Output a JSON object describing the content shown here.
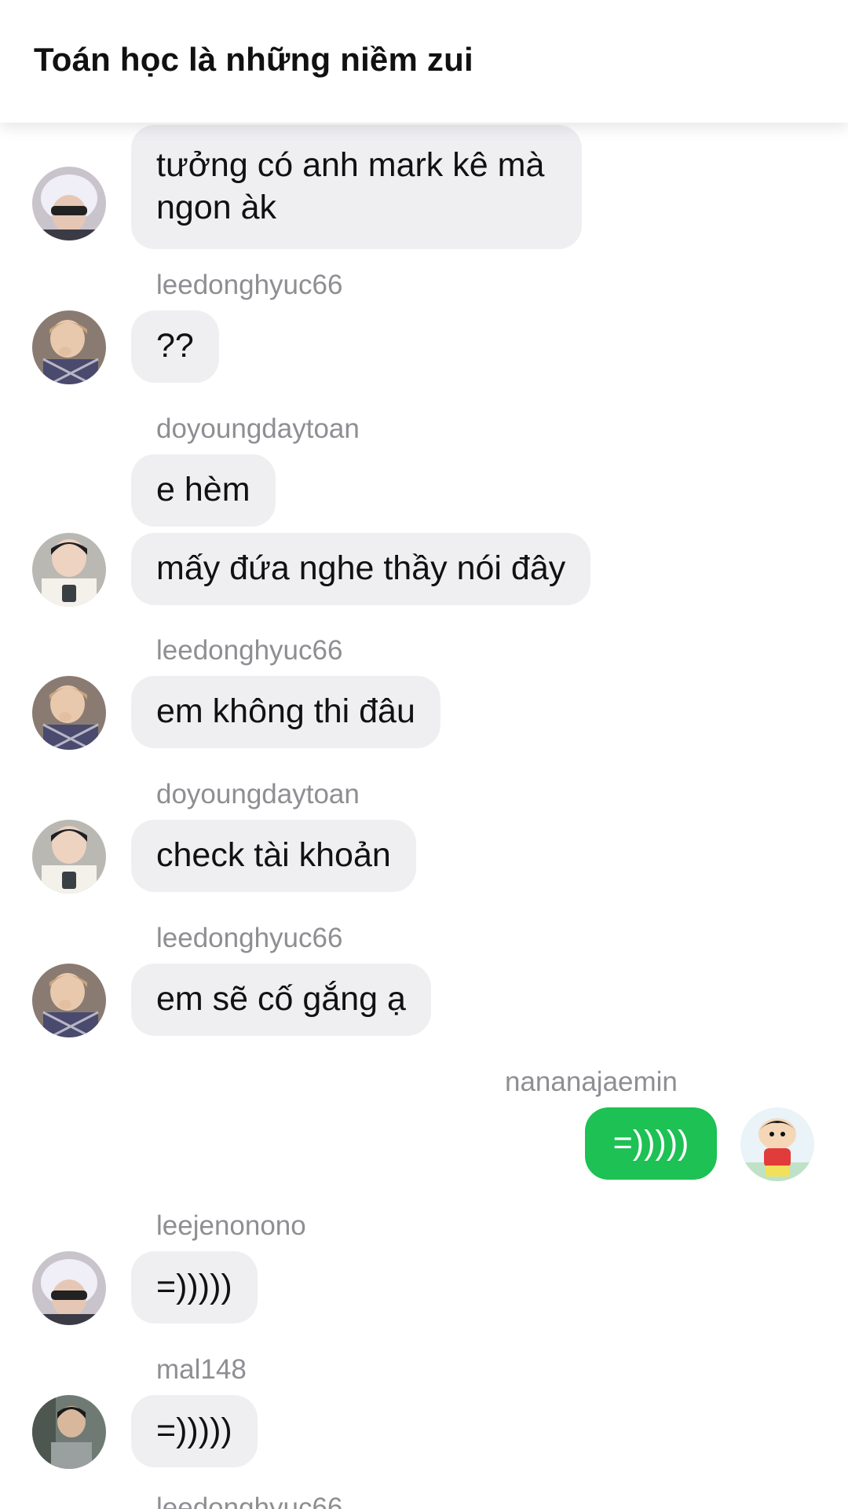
{
  "header": {
    "title": "Toán học là những niềm zui"
  },
  "messages": [
    {
      "sender": "",
      "text": "tưởng có anh mark kê mà ngon àk"
    },
    {
      "sender": "leedonghyuc66",
      "text": "??"
    },
    {
      "sender": "doyoungdaytoan",
      "text": "e hèm"
    },
    {
      "sender": "",
      "text": "mấy đứa nghe thầy nói đây"
    },
    {
      "sender": "leedonghyuc66",
      "text": "em không thi đâu"
    },
    {
      "sender": "doyoungdaytoan",
      "text": "check tài khoản"
    },
    {
      "sender": "leedonghyuc66",
      "text": "em sẽ cố gắng ạ"
    },
    {
      "sender": "nananajaemin",
      "text": "=)))))"
    },
    {
      "sender": "leejenonono",
      "text": "=)))))"
    },
    {
      "sender": "mal148",
      "text": "=)))))"
    }
  ],
  "partial_next_sender": "leedonghyuc66",
  "colors": {
    "received_bubble": "#efeff2",
    "sent_bubble": "#1dc154",
    "sender_name": "#8e8e93"
  }
}
